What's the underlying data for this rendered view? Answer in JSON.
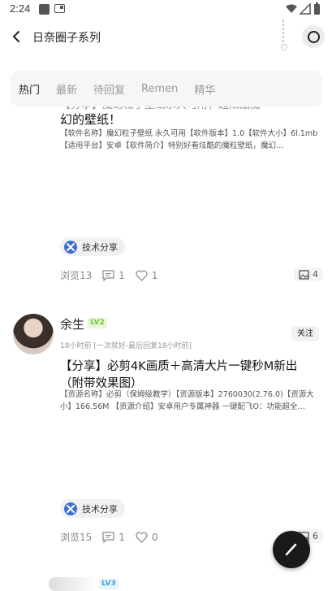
{
  "status_bar": {
    "time": "2:24"
  },
  "nav": {
    "title": "日奈圈子系列"
  },
  "tabs": [
    {
      "label": "热门",
      "active": true
    },
    {
      "label": "最新",
      "active": false
    },
    {
      "label": "待回复",
      "active": false
    },
    {
      "label": "Remen",
      "active": false
    },
    {
      "label": "精华",
      "active": false
    }
  ],
  "posts": [
    {
      "cut_line": "【分享】魔幻粒子壁纸永久可用，超炫酷魔",
      "title": "幻的壁纸！",
      "desc": "【软件名称】魔幻粒子壁纸 永久可用【软件版本】1.0【软件大小】6l.1mb【适用平台】安卓【软件简介】特别好看炫酷的魔粒壁纸，魔幻…",
      "tag": "技术分享",
      "views": "浏览13",
      "comments": "1",
      "likes": "1",
      "images": "4"
    },
    {
      "username": "余生",
      "level": "LV2",
      "meta": "18小时前 [一次就好-最后回复18小时前]",
      "follow": "关注",
      "title": "【分享】必剪4K画质＋高清大片一键秒M新出（附带效果图）",
      "desc": "【资源名称】必剪（保姆级教学）【资源版本】2760030(2.76.0)【资源大小】166.56M 【资源介绍】安卓用户专属神器 一键配飞O：功能超全…",
      "tag": "技术分享",
      "views": "浏览15",
      "comments": "1",
      "likes": "0",
      "images": "6"
    },
    {
      "level": "LV3"
    }
  ],
  "colors": {
    "tag_icon": "#3b6ed6",
    "lv2": "#79c23a",
    "lv3": "#3aa6e0",
    "fab": "#1a1a1a"
  }
}
